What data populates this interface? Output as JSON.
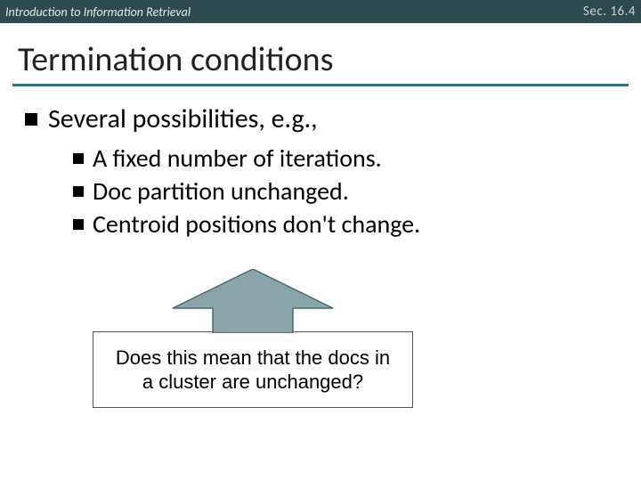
{
  "header": {
    "left": "Introduction to Information Retrieval",
    "right": "Sec. 16.4"
  },
  "title": "Termination conditions",
  "bullets": {
    "main": "Several possibilities, e.g.,",
    "subs": [
      "A fixed number of iterations.",
      "Doc partition unchanged.",
      "Centroid positions don't change."
    ]
  },
  "callout": "Does this mean that the docs in a cluster are unchanged?",
  "colors": {
    "header_bg": "#2d4a50",
    "accent": "#376f7a",
    "arrow_fill": "#8aa5a9"
  }
}
